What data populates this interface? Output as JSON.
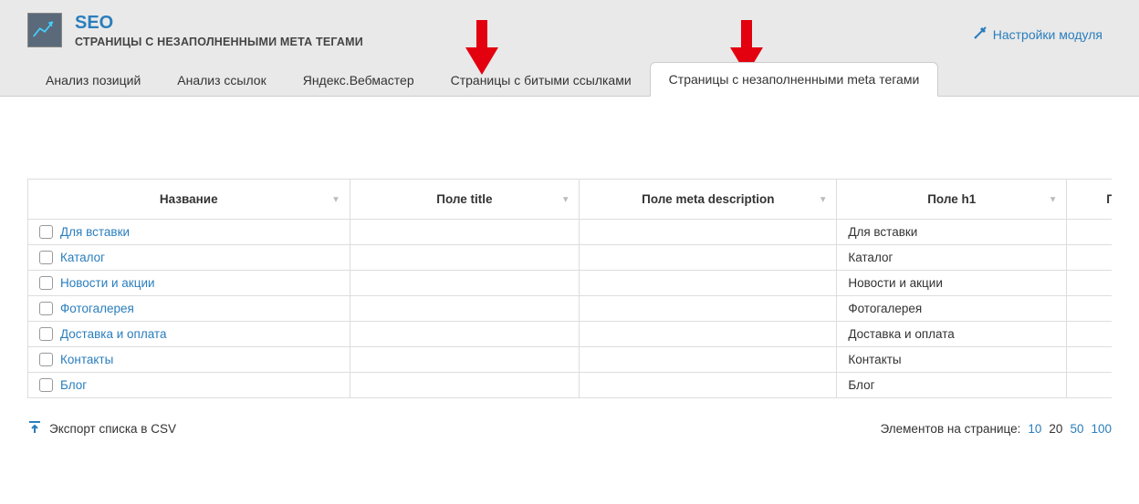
{
  "header": {
    "title": "SEO",
    "subtitle": "СТРАНИЦЫ С НЕЗАПОЛНЕННЫМИ МЕТА ТЕГАМИ",
    "settings_label": "Настройки модуля"
  },
  "tabs": {
    "t0": "Анализ позиций",
    "t1": "Анализ ссылок",
    "t2": "Яндекс.Вебмастер",
    "t3": "Страницы с битыми ссылками",
    "t4": "Страницы с незаполненными meta тегами"
  },
  "columns": {
    "name": "Название",
    "title": "Поле title",
    "meta": "Поле meta description",
    "h1": "Поле h1",
    "extra": "Поле"
  },
  "rows": [
    {
      "name": "Для вставки",
      "title": "",
      "meta": "",
      "h1": "Для вставки"
    },
    {
      "name": "Каталог",
      "title": "",
      "meta": "",
      "h1": "Каталог"
    },
    {
      "name": "Новости и акции",
      "title": "",
      "meta": "",
      "h1": "Новости и акции"
    },
    {
      "name": "Фотогалерея",
      "title": "",
      "meta": "",
      "h1": "Фотогалерея"
    },
    {
      "name": "Доставка и оплата",
      "title": "",
      "meta": "",
      "h1": "Доставка и оплата"
    },
    {
      "name": "Контакты",
      "title": "",
      "meta": "",
      "h1": "Контакты"
    },
    {
      "name": "Блог",
      "title": "",
      "meta": "",
      "h1": "Блог"
    }
  ],
  "footer": {
    "export": "Экспорт списка в CSV",
    "pager_label": "Элементов на странице:",
    "pager_options": {
      "o0": "10",
      "o1": "20",
      "o2": "50",
      "o3": "100"
    }
  }
}
